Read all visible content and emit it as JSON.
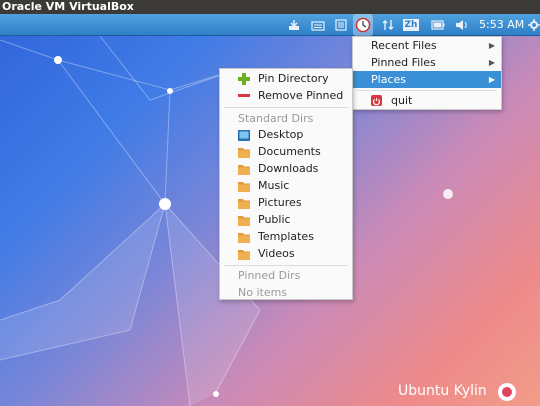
{
  "window": {
    "title": "Oracle VM VirtualBox"
  },
  "panel": {
    "clock": "5:53 AM",
    "tray_icons": [
      "download-icon",
      "keyboard-icon",
      "file-manager-icon",
      "clock-icon",
      "network-icon",
      "input-method-icon",
      "battery-icon",
      "volume-icon",
      "settings-icon"
    ],
    "input_method_label": "Zh"
  },
  "main_menu": {
    "items": [
      {
        "label": "Recent Files",
        "has_submenu": true
      },
      {
        "label": "Pinned Files",
        "has_submenu": true
      },
      {
        "label": "Places",
        "has_submenu": true,
        "selected": true
      }
    ],
    "quit_label": "quit"
  },
  "places_menu": {
    "pin_directory": "Pin Directory",
    "remove_pinned": "Remove Pinned",
    "standard_header": "Standard Dirs",
    "standard_dirs": [
      {
        "label": "Desktop",
        "icon": "desktop-icon"
      },
      {
        "label": "Documents",
        "icon": "folder-icon"
      },
      {
        "label": "Downloads",
        "icon": "folder-icon"
      },
      {
        "label": "Music",
        "icon": "folder-icon"
      },
      {
        "label": "Pictures",
        "icon": "folder-icon"
      },
      {
        "label": "Public",
        "icon": "folder-icon"
      },
      {
        "label": "Templates",
        "icon": "folder-icon"
      },
      {
        "label": "Videos",
        "icon": "folder-icon"
      }
    ],
    "pinned_header": "Pinned Dirs",
    "no_items": "No items"
  },
  "desktop": {
    "brand_name": "Ubuntu Kylin"
  },
  "colors": {
    "panel": "#3f93d6",
    "selection": "#3a90d6",
    "folder": "#e09a3a",
    "add": "#6ab31f",
    "remove": "#d9363e",
    "quit": "#d9363e"
  }
}
